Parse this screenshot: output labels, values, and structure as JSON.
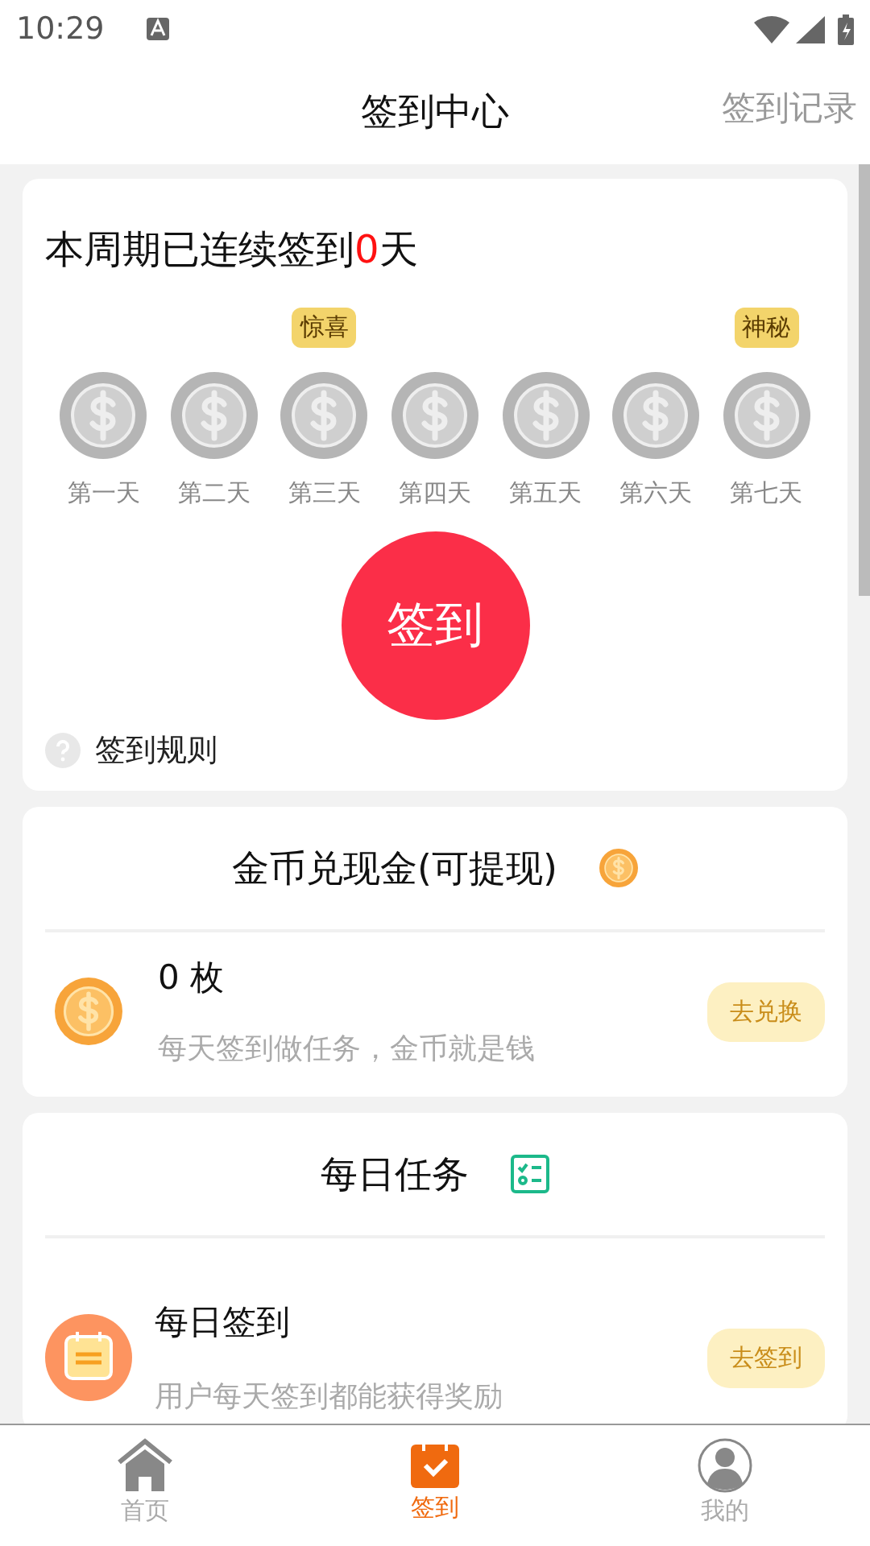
{
  "status_bar": {
    "time": "10:29"
  },
  "header": {
    "title": "签到中心",
    "action": "签到记录"
  },
  "streak": {
    "prefix": "本周期已连续签到",
    "count": "0",
    "suffix": "天"
  },
  "days": [
    {
      "label": "第一天",
      "signed": false
    },
    {
      "label": "第二天",
      "signed": false
    },
    {
      "label": "第三天",
      "signed": false,
      "badge": "惊喜"
    },
    {
      "label": "第四天",
      "signed": false
    },
    {
      "label": "第五天",
      "signed": false
    },
    {
      "label": "第六天",
      "signed": false
    },
    {
      "label": "第七天",
      "signed": false,
      "badge": "神秘"
    }
  ],
  "sign_button": "签到",
  "rules_link": "签到规则",
  "exchange": {
    "title": "金币兑现金(可提现)",
    "amount": "0 枚",
    "description": "每天签到做任务，金币就是钱",
    "button": "去兑换"
  },
  "tasks": {
    "title": "每日任务",
    "items": [
      {
        "title": "每日签到",
        "description": "用户每天签到都能获得奖励",
        "button": "去签到"
      }
    ]
  },
  "tabs": [
    {
      "label": "首页",
      "kind": "home",
      "selected": false
    },
    {
      "label": "签到",
      "kind": "checkin",
      "selected": true
    },
    {
      "label": "我的",
      "kind": "profile",
      "selected": false
    }
  ]
}
